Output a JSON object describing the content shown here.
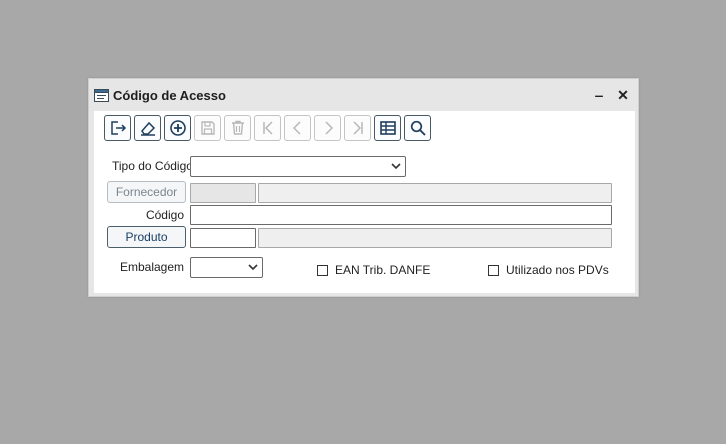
{
  "window": {
    "title": "Código de Acesso",
    "minimize_label": "‒",
    "close_label": "✕"
  },
  "toolbar": {
    "buttons": [
      {
        "name": "exit",
        "icon": "exit-icon",
        "enabled": true
      },
      {
        "name": "clear",
        "icon": "eraser-icon",
        "enabled": true
      },
      {
        "name": "add",
        "icon": "plus-circle-icon",
        "enabled": true
      },
      {
        "name": "save",
        "icon": "floppy-icon",
        "enabled": false
      },
      {
        "name": "delete",
        "icon": "trash-icon",
        "enabled": false
      },
      {
        "name": "first",
        "icon": "first-record-icon",
        "enabled": false
      },
      {
        "name": "previous",
        "icon": "previous-record-icon",
        "enabled": false
      },
      {
        "name": "next",
        "icon": "next-record-icon",
        "enabled": false
      },
      {
        "name": "last",
        "icon": "last-record-icon",
        "enabled": false
      },
      {
        "name": "grid",
        "icon": "table-icon",
        "enabled": true
      },
      {
        "name": "search",
        "icon": "search-icon",
        "enabled": true
      }
    ]
  },
  "form": {
    "tipo_label": "Tipo do Código",
    "tipo_value": "",
    "fornecedor_button": "Fornecedor",
    "fornecedor_code": "",
    "fornecedor_name": "",
    "codigo_label": "Código",
    "codigo_value": "",
    "produto_button": "Produto",
    "produto_code": "",
    "produto_name": "",
    "embalagem_label": "Embalagem",
    "embalagem_value": "",
    "ean_label": "EAN Trib. DANFE",
    "ean_checked": false,
    "pdv_label": "Utilizado nos PDVs",
    "pdv_checked": false
  },
  "colors": {
    "background": "#a8a8a8",
    "window": "#e6e6e6",
    "accent_text": "#1a3e63",
    "icon": "#1f3f5f",
    "icon_disabled": "#b8b8b8"
  }
}
